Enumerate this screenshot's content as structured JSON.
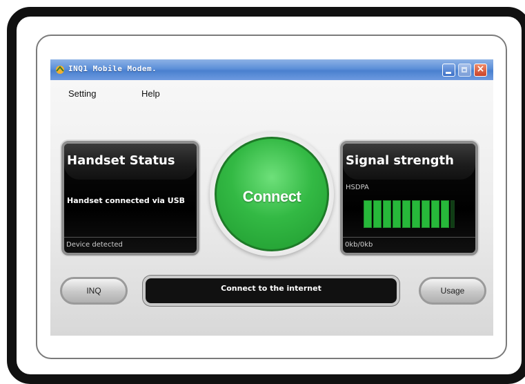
{
  "window": {
    "title": "INQ1 Mobile Modem."
  },
  "menu": {
    "items": [
      {
        "label": "Setting"
      },
      {
        "label": "Help"
      }
    ]
  },
  "handset_panel": {
    "title": "Handset Status",
    "message": "Handset connected via USB",
    "footer": "Device detected"
  },
  "signal_panel": {
    "title": "Signal strength",
    "network_type": "HSDPA",
    "bars_total": 10,
    "bars_filled": 9,
    "footer": "0kb/0kb"
  },
  "connect_button": {
    "label": "Connect"
  },
  "status_bar": {
    "text": "Connect to the internet"
  },
  "buttons": {
    "inq": "INQ",
    "usage": "Usage"
  },
  "colors": {
    "titlebar": "#5c8fd8",
    "connect_green": "#33b944",
    "signal_green": "#27b83a",
    "panel_black": "#000000"
  },
  "icons": {
    "app": "modem-app-icon",
    "minimize": "minimize-icon",
    "maximize": "maximize-icon",
    "close": "close-icon"
  }
}
